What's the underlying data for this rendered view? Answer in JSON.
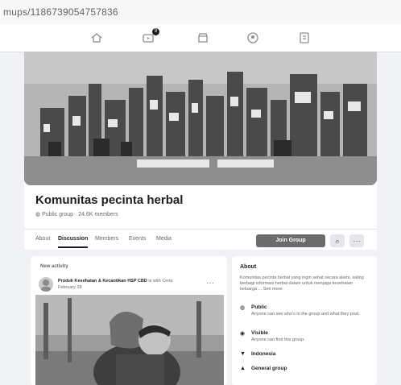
{
  "browser": {
    "url": "mups/1186739054757836"
  },
  "nav": {
    "icons": [
      "home-icon",
      "watch-icon",
      "marketplace-icon",
      "groups-icon",
      "gaming-icon"
    ],
    "badge": "9"
  },
  "group": {
    "name": "Komunitas pecinta herbal",
    "meta": "Public group · 24.6K members"
  },
  "tabs": [
    {
      "label": "About"
    },
    {
      "label": "Discussion"
    },
    {
      "label": "Members"
    },
    {
      "label": "Events"
    },
    {
      "label": "Media"
    }
  ],
  "actions": {
    "join_label": "Join Group",
    "search_glyph": "⌕",
    "more_glyph": "···"
  },
  "feed": {
    "section_label": "New activity",
    "post": {
      "author": "Produk Kesehatan & Kecantikan HSP CBD",
      "author_suffix": "is with Ceria",
      "time": "February 28"
    }
  },
  "about": {
    "title": "About",
    "description": "Komunitas pecinta herbal yang ingin sehat secara alami, saling berbagi informasi herbal dalam untuk menjaga kesehatan keluarga ... See more",
    "items": [
      {
        "icon": "globe-icon",
        "glyph": "◍",
        "label": "Public",
        "sub": "Anyone can see who's in the group and what they post."
      },
      {
        "icon": "eye-icon",
        "glyph": "◉",
        "label": "Visible",
        "sub": "Anyone can find this group."
      },
      {
        "icon": "location-icon",
        "glyph": "▼",
        "label": "Indonesia",
        "sub": ""
      },
      {
        "icon": "group-icon",
        "glyph": "▲",
        "label": "General group",
        "sub": ""
      }
    ]
  },
  "colors": {
    "join_button": "#6b6b6b",
    "page_bg": "#f0f2f5"
  }
}
